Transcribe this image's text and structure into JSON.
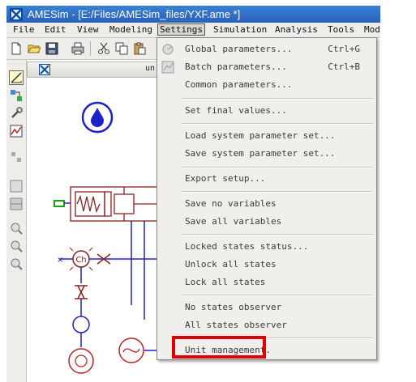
{
  "window": {
    "title": "AMESim - [E:/Files/AMESim_files/YXF.ame *]"
  },
  "menubar": {
    "items": [
      "File",
      "Edit",
      "View",
      "Modeling",
      "Settings",
      "Simulation",
      "Analysis",
      "Tools",
      "Mod"
    ],
    "active": "Settings"
  },
  "document_tab": {
    "label": "un"
  },
  "settings_menu": {
    "items": [
      {
        "label": "Global parameters...",
        "shortcut": "Ctrl+G",
        "icon": "global-parameters-icon"
      },
      {
        "label": "Batch parameters...",
        "shortcut": "Ctrl+B",
        "icon": "batch-parameters-icon"
      },
      {
        "label": "Common parameters..."
      },
      {
        "label": "Set final values..."
      },
      {
        "label": "Load system parameter set..."
      },
      {
        "label": "Save system parameter set..."
      },
      {
        "label": "Export setup..."
      },
      {
        "label": "Save no variables"
      },
      {
        "label": "Save all variables"
      },
      {
        "label": "Locked states status..."
      },
      {
        "label": "Unlock all states"
      },
      {
        "label": "Lock all states"
      },
      {
        "label": "No states observer"
      },
      {
        "label": "All states observer"
      },
      {
        "label": "Unit management."
      }
    ],
    "highlighted_item": "Unit management.",
    "highlight_color": "#e00000"
  },
  "diagram": {
    "component_label": "Ch"
  }
}
